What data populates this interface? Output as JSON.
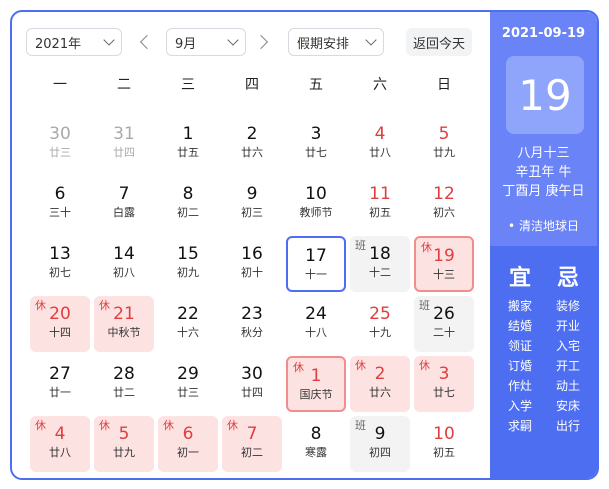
{
  "header": {
    "year_select": "2021年",
    "month_select": "9月",
    "holiday_select": "假期安排",
    "today_button": "返回今天"
  },
  "weekdays": [
    "一",
    "二",
    "三",
    "四",
    "五",
    "六",
    "日"
  ],
  "days": [
    {
      "num": "30",
      "lunar": "廿三",
      "status": "other",
      "weekend": false,
      "badge": ""
    },
    {
      "num": "31",
      "lunar": "廿四",
      "status": "other",
      "weekend": false,
      "badge": ""
    },
    {
      "num": "1",
      "lunar": "廿五",
      "status": "",
      "weekend": false,
      "badge": ""
    },
    {
      "num": "2",
      "lunar": "廿六",
      "status": "",
      "weekend": false,
      "badge": ""
    },
    {
      "num": "3",
      "lunar": "廿七",
      "status": "",
      "weekend": false,
      "badge": ""
    },
    {
      "num": "4",
      "lunar": "廿八",
      "status": "",
      "weekend": true,
      "badge": ""
    },
    {
      "num": "5",
      "lunar": "廿九",
      "status": "",
      "weekend": true,
      "badge": ""
    },
    {
      "num": "6",
      "lunar": "三十",
      "status": "",
      "weekend": false,
      "badge": ""
    },
    {
      "num": "7",
      "lunar": "白露",
      "status": "",
      "weekend": false,
      "badge": ""
    },
    {
      "num": "8",
      "lunar": "初二",
      "status": "",
      "weekend": false,
      "badge": ""
    },
    {
      "num": "9",
      "lunar": "初三",
      "status": "",
      "weekend": false,
      "badge": ""
    },
    {
      "num": "10",
      "lunar": "教师节",
      "status": "",
      "weekend": false,
      "badge": ""
    },
    {
      "num": "11",
      "lunar": "初五",
      "status": "",
      "weekend": true,
      "badge": ""
    },
    {
      "num": "12",
      "lunar": "初六",
      "status": "",
      "weekend": true,
      "badge": ""
    },
    {
      "num": "13",
      "lunar": "初七",
      "status": "",
      "weekend": false,
      "badge": ""
    },
    {
      "num": "14",
      "lunar": "初八",
      "status": "",
      "weekend": false,
      "badge": ""
    },
    {
      "num": "15",
      "lunar": "初九",
      "status": "",
      "weekend": false,
      "badge": ""
    },
    {
      "num": "16",
      "lunar": "初十",
      "status": "",
      "weekend": false,
      "badge": ""
    },
    {
      "num": "17",
      "lunar": "十一",
      "status": "today",
      "weekend": false,
      "badge": ""
    },
    {
      "num": "18",
      "lunar": "十二",
      "status": "work",
      "weekend": false,
      "badge": "班"
    },
    {
      "num": "19",
      "lunar": "十三",
      "status": "rest selected",
      "weekend": true,
      "badge": "休"
    },
    {
      "num": "20",
      "lunar": "十四",
      "status": "rest",
      "weekend": false,
      "badge": "休"
    },
    {
      "num": "21",
      "lunar": "中秋节",
      "status": "rest",
      "weekend": false,
      "badge": "休"
    },
    {
      "num": "22",
      "lunar": "十六",
      "status": "",
      "weekend": false,
      "badge": ""
    },
    {
      "num": "23",
      "lunar": "秋分",
      "status": "",
      "weekend": false,
      "badge": ""
    },
    {
      "num": "24",
      "lunar": "十八",
      "status": "",
      "weekend": false,
      "badge": ""
    },
    {
      "num": "25",
      "lunar": "十九",
      "status": "",
      "weekend": true,
      "badge": ""
    },
    {
      "num": "26",
      "lunar": "二十",
      "status": "work",
      "weekend": false,
      "badge": "班"
    },
    {
      "num": "27",
      "lunar": "廿一",
      "status": "",
      "weekend": false,
      "badge": ""
    },
    {
      "num": "28",
      "lunar": "廿二",
      "status": "",
      "weekend": false,
      "badge": ""
    },
    {
      "num": "29",
      "lunar": "廿三",
      "status": "",
      "weekend": false,
      "badge": ""
    },
    {
      "num": "30",
      "lunar": "廿四",
      "status": "",
      "weekend": false,
      "badge": ""
    },
    {
      "num": "1",
      "lunar": "国庆节",
      "status": "rest selected",
      "weekend": false,
      "badge": "休"
    },
    {
      "num": "2",
      "lunar": "廿六",
      "status": "rest",
      "weekend": true,
      "badge": "休"
    },
    {
      "num": "3",
      "lunar": "廿七",
      "status": "rest",
      "weekend": true,
      "badge": "休"
    },
    {
      "num": "4",
      "lunar": "廿八",
      "status": "rest",
      "weekend": false,
      "badge": "休"
    },
    {
      "num": "5",
      "lunar": "廿九",
      "status": "rest",
      "weekend": false,
      "badge": "休"
    },
    {
      "num": "6",
      "lunar": "初一",
      "status": "rest",
      "weekend": false,
      "badge": "休"
    },
    {
      "num": "7",
      "lunar": "初二",
      "status": "rest",
      "weekend": false,
      "badge": "休"
    },
    {
      "num": "8",
      "lunar": "寒露",
      "status": "",
      "weekend": false,
      "badge": ""
    },
    {
      "num": "9",
      "lunar": "初四",
      "status": "work",
      "weekend": false,
      "badge": "班"
    },
    {
      "num": "10",
      "lunar": "初五",
      "status": "",
      "weekend": true,
      "badge": ""
    }
  ],
  "detail": {
    "date": "2021-09-19",
    "day": "19",
    "lunar_line1": "八月十三",
    "lunar_line2": "辛丑年 牛",
    "lunar_line3": "丁酉月 庚午日",
    "festival": "• 清洁地球日",
    "yi_label": "宜",
    "ji_label": "忌",
    "yi": [
      "搬家",
      "结婚",
      "领证",
      "订婚",
      "作灶",
      "入学",
      "求嗣"
    ],
    "ji": [
      "装修",
      "开业",
      "入宅",
      "开工",
      "动土",
      "安床",
      "出行"
    ]
  },
  "colors": {
    "accent": "#4e6ef2",
    "panel": "#6a83f7",
    "holiday_red": "#e03e3e",
    "rest_bg": "#fde2e2",
    "work_bg": "#f3f3f3"
  }
}
